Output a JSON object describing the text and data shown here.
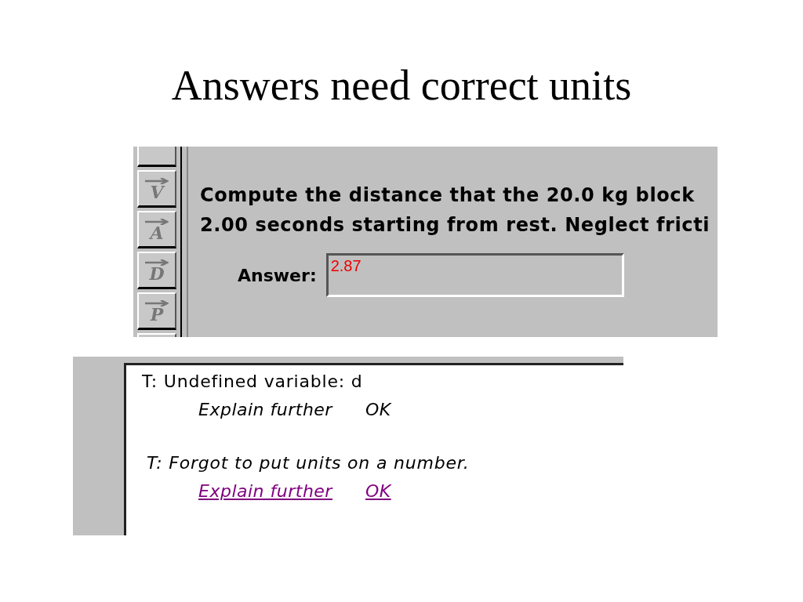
{
  "slide_title": "Answers need correct units",
  "problem_window": {
    "tool_buttons": [
      {
        "kind": "partial"
      },
      {
        "kind": "vector",
        "label": "V"
      },
      {
        "kind": "vector",
        "label": "A"
      },
      {
        "kind": "vector",
        "label": "D"
      },
      {
        "kind": "vector",
        "label": "P"
      },
      {
        "kind": "partial"
      }
    ],
    "question_lines": [
      "Compute the distance that the 20.0 kg block",
      "2.00 seconds starting from rest. Neglect fricti"
    ],
    "answer": {
      "label": "Answer:",
      "value": "2.87"
    }
  },
  "hint_window": {
    "messages": [
      {
        "text": "T: Undefined variable: d",
        "italic": false,
        "links": [
          {
            "label": "Explain further",
            "active": false
          },
          {
            "label": "OK",
            "active": false
          }
        ]
      },
      {
        "text": "T: Forgot to put units on a number.",
        "italic": true,
        "links": [
          {
            "label": "Explain further",
            "active": true
          },
          {
            "label": "OK",
            "active": true
          }
        ]
      }
    ]
  }
}
